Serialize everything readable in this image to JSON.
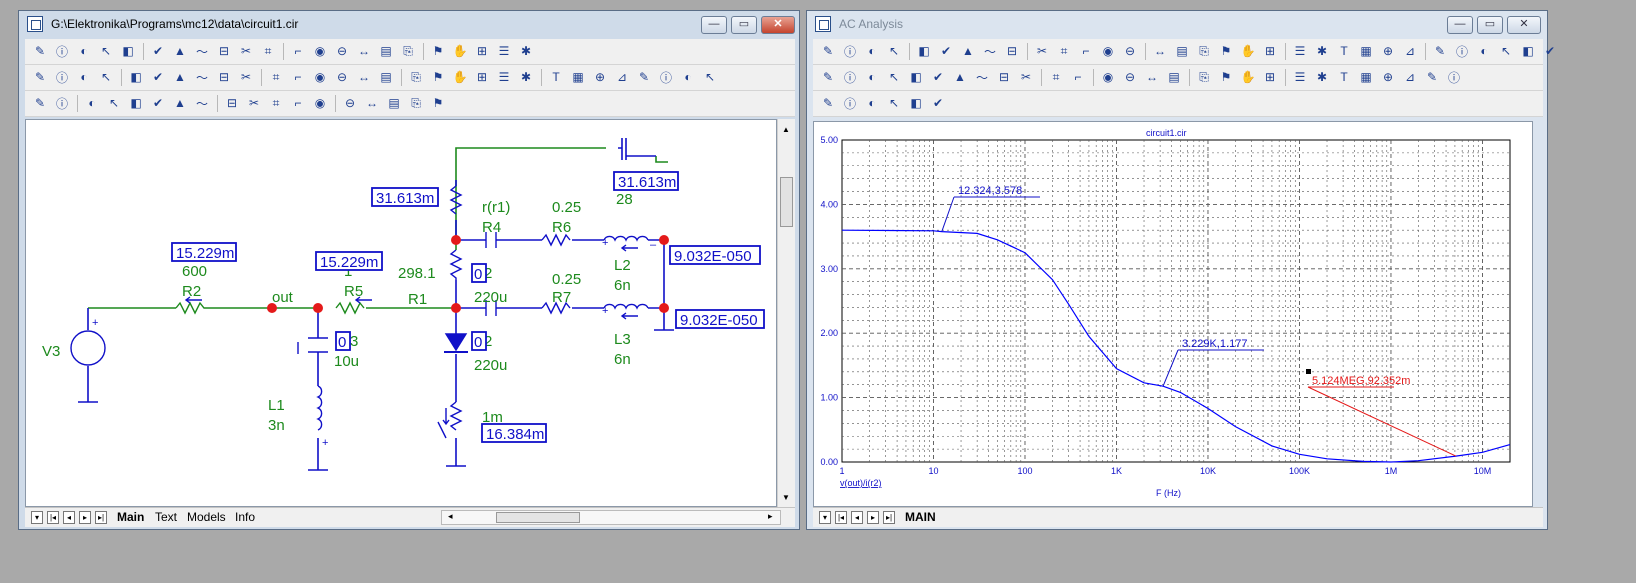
{
  "schematic_window": {
    "title": "G:\\Elektronika\\Programs\\mc12\\data\\circuit1.cir",
    "tabs": [
      "Main",
      "Text",
      "Models",
      "Info"
    ],
    "active_tab": "Main"
  },
  "schematic": {
    "node_label": "out",
    "source": {
      "name": "V3"
    },
    "boxes": {
      "r2_current": "15.229m",
      "r5_current": "15.229m",
      "r4_current": "31.613m",
      "mosfet_value": "31.613m",
      "l2_value": "9.032E-050",
      "l3_value": "9.032E-050",
      "zener_value": "16.384m",
      "c3_box": "0",
      "c_top_box": "0",
      "c_mid_box": "0"
    },
    "components": {
      "r2_value": "600",
      "r2_name": "R2",
      "r5_value": "1",
      "r5_name": "R5",
      "c3_suffix": "3",
      "c3_value": "10u",
      "l1_name": "L1",
      "l1_value": "3n",
      "r1_value": "298.1",
      "r1_name": "R1",
      "r4_value": "r(r1)",
      "r4_name": "R4",
      "c_top_suffix": "2",
      "c_top_value": "220u",
      "c_mid_suffix": "2",
      "c_mid_value": "220u",
      "r6_value": "0.25",
      "r6_name": "R6",
      "r7_value": "0.25",
      "r7_name": "R7",
      "l2_name": "L2",
      "l2_value": "6n",
      "l3_name": "L3",
      "l3_value": "6n",
      "mosfet_label": "28",
      "zener_value": "1m"
    }
  },
  "analysis_window": {
    "title": "AC Analysis",
    "tabs": [
      "MAIN"
    ],
    "active_tab": "MAIN"
  },
  "plot": {
    "ytick_labels": [
      "5.00",
      "4.00",
      "3.00",
      "2.00",
      "1.00",
      "0.00"
    ],
    "xtick_labels": [
      "1",
      "10",
      "100",
      "1K",
      "10K",
      "100K",
      "1M",
      "10M"
    ],
    "annotations": {
      "a1": "12.324,3.578",
      "a2": "3.229K,1.177",
      "a3": "5.124MEG,92.352m"
    },
    "colors": {
      "curve": "#0000ff",
      "annotation_red": "#ff0000",
      "grid": "#000000"
    }
  },
  "chart_data": {
    "type": "line",
    "title": "circuit1.cir",
    "xlabel": "F (Hz)",
    "ylabel": "v(out)/i(r2)",
    "xscale": "log",
    "xlim": [
      1,
      20000000
    ],
    "ylim": [
      0,
      5
    ],
    "grid": true,
    "series": [
      {
        "name": "v(out)/i(r2)",
        "color": "#0000ff",
        "x": [
          1,
          10,
          12.324,
          30,
          50,
          100,
          200,
          300,
          500,
          1000,
          2000,
          3229,
          5000,
          10000,
          20000,
          50000,
          100000,
          200000,
          500000,
          1000000,
          2000000,
          5124000,
          10000000,
          20000000
        ],
        "y": [
          3.6,
          3.59,
          3.578,
          3.55,
          3.45,
          3.25,
          2.83,
          2.45,
          1.95,
          1.45,
          1.23,
          1.177,
          1.08,
          0.83,
          0.55,
          0.25,
          0.12,
          0.05,
          0.01,
          0.0,
          0.02,
          0.092,
          0.15,
          0.27
        ]
      }
    ]
  }
}
